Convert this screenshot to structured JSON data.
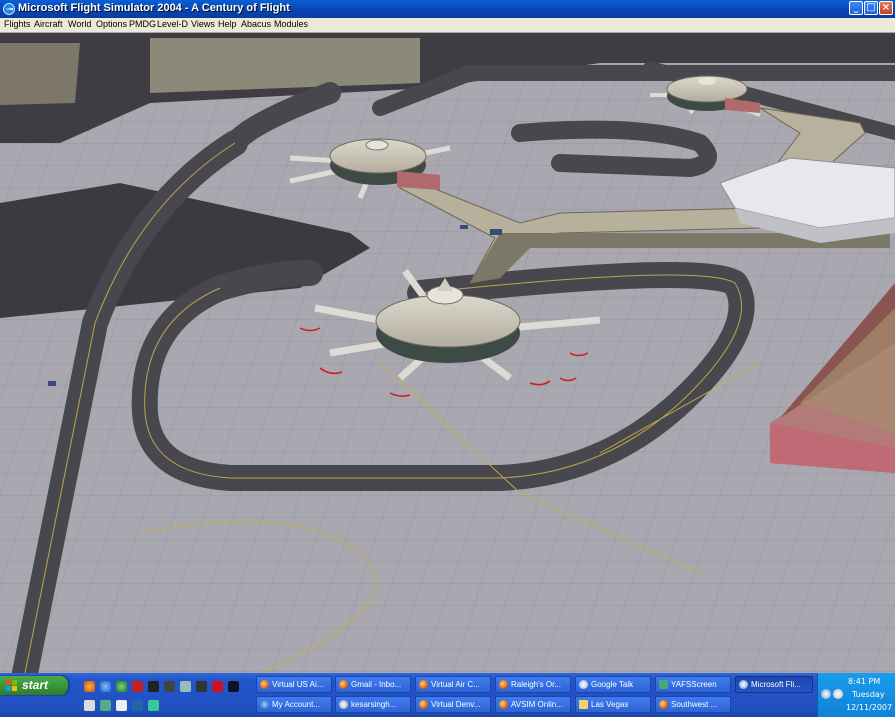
{
  "window": {
    "title": "Microsoft Flight Simulator 2004 - A Century of Flight"
  },
  "menu": [
    "Flights",
    "Aircraft",
    "World",
    "Options",
    "PMDG",
    "Level-D",
    "Views",
    "Help",
    "Abacus",
    "Modules"
  ],
  "taskbar": {
    "start_label": "start",
    "quick_launch_icons": [
      "firefox-icon",
      "ie-icon",
      "globe-icon",
      "z-icon",
      "app-icon",
      "app-icon",
      "plane-icon",
      "fsx-icon",
      "app-icon",
      "app-icon",
      "app-icon",
      "app-icon",
      "app-icon",
      "app-icon",
      "app-icon"
    ],
    "tasks_row1": [
      "Virtual US Ai...",
      "Gmail - Inbo...",
      "Virtual Air C...",
      "Raleigh's Or...",
      "Google Talk",
      "YAFSScreen",
      "Microsoft Fli..."
    ],
    "tasks_row2": [
      "My Account...",
      "kesarsingh...",
      "Virtual Denv...",
      "AVSIM Onlin...",
      "Las Vegas",
      "Southwest ..."
    ],
    "active_task": "Microsoft Fli..."
  },
  "clock": {
    "time": "8:41 PM",
    "day": "Tuesday",
    "date": "12/11/2007"
  },
  "colors": {
    "titlebar": "#0842b0",
    "taskbar": "#2456c9",
    "start": "#3a963a",
    "tray": "#0f83d8",
    "tarmac": "#a7a5ad",
    "taxiway": "#46464c"
  }
}
